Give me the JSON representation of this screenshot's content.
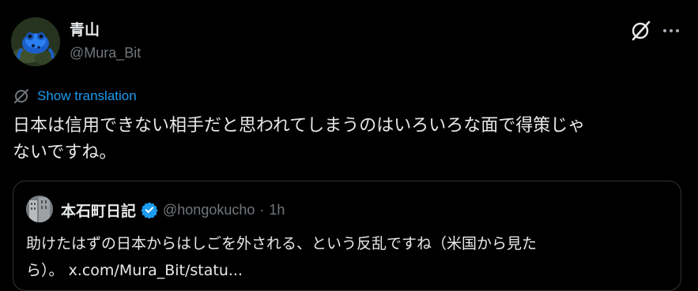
{
  "author": {
    "name": "青山",
    "handle": "@Mura_Bit"
  },
  "icons": {
    "avatar": "blue-frog-avatar",
    "grok": "grok-icon",
    "more": "more-options-icon",
    "translate": "translate-icon",
    "verified": "verified-badge-icon"
  },
  "translation": {
    "label": "Show translation"
  },
  "tweet": {
    "text": "日本は信用できない相手だと思われてしまうのはいろいろな面で得策じゃ\nないですね。"
  },
  "quote": {
    "name": "本石町日記",
    "handle": "@hongokucho",
    "separator": "·",
    "time": "1h",
    "line1": "助けたはずの日本からはしごを外される、という反乱ですね（米国から見た",
    "line2_prefix": "ら）。",
    "link": "x.com/Mura_Bit/statu..."
  },
  "colors": {
    "background": "#000000",
    "text": "#e7e9ea",
    "secondary": "#71767b",
    "link": "#1d9bf0",
    "border": "#2f3336"
  }
}
